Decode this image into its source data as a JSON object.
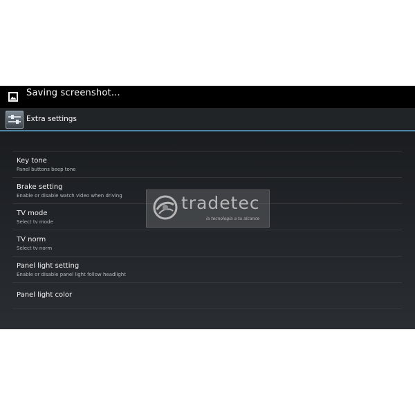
{
  "notification": {
    "text": "Saving screenshot...",
    "icon": "image-icon"
  },
  "action_bar": {
    "title": "Extra settings",
    "icon": "settings-app-icon"
  },
  "settings": [
    {
      "title": "Key tone",
      "subtitle": "Panel buttons beep tone"
    },
    {
      "title": "Brake setting",
      "subtitle": "Enable or disable watch video when driving"
    },
    {
      "title": "TV mode",
      "subtitle": "Select tv mode"
    },
    {
      "title": "TV norm",
      "subtitle": "Select tv norm"
    },
    {
      "title": "Panel light setting",
      "subtitle": "Enable or disable panel light follow headlight"
    },
    {
      "title": "Panel light color",
      "subtitle": ""
    }
  ],
  "watermark": {
    "brand": "tradetec",
    "tagline": "la tecnología a tu alcance"
  },
  "colors": {
    "accent_line": "#4d87a8",
    "notification_bg": "#000000",
    "divider": "#34383d"
  }
}
